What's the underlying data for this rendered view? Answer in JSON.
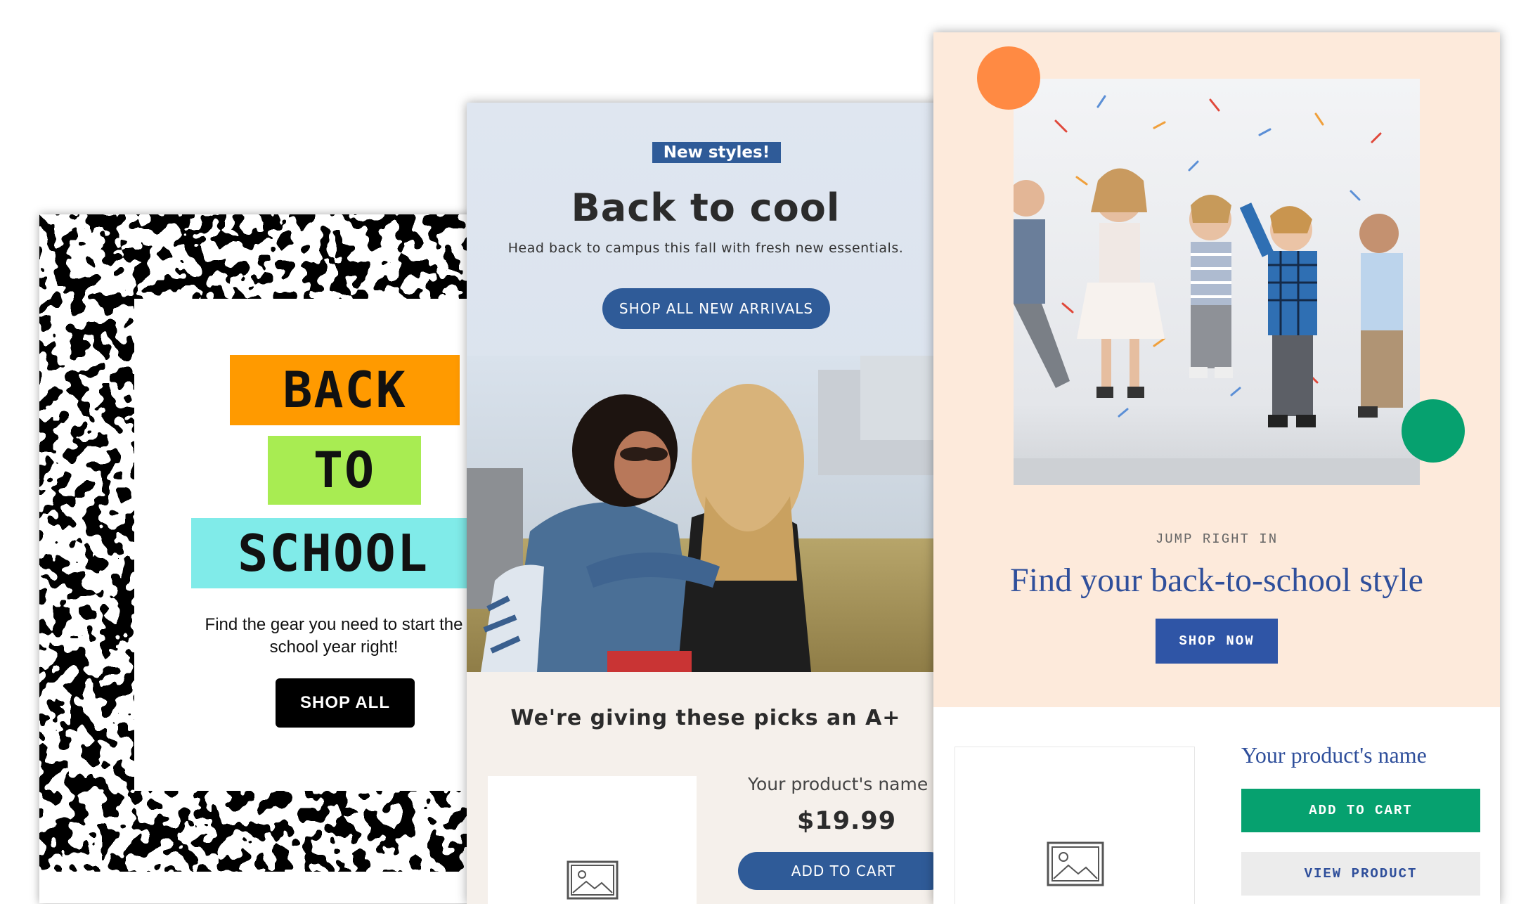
{
  "card_school": {
    "title_line1": "BACK",
    "title_line2": "TO",
    "title_line3": "SCHOOL",
    "subtext": "Find the gear you need to start the school year right!",
    "button_label": "SHOP ALL",
    "colors": {
      "orange": "#ff9a00",
      "green": "#a8ec52",
      "cyan": "#80ebe9"
    }
  },
  "card_cool": {
    "badge": "New styles!",
    "headline": "Back to cool",
    "subtext": "Head back to campus this fall with fresh new essentials.",
    "primary_button": "SHOP ALL NEW ARRIVALS",
    "section_title": "We're giving these picks an A+",
    "product_name": "Your product's name",
    "price": "$19.99",
    "add_to_cart": "ADD TO CART",
    "image_icon": "image-placeholder-icon",
    "colors": {
      "accent": "#2f5b98",
      "background": "#f5f0eb"
    }
  },
  "card_jump": {
    "kicker": "JUMP RIGHT IN",
    "headline": "Find your back-to-school style",
    "primary_button": "SHOP NOW",
    "product_name": "Your product's name",
    "add_to_cart": "ADD TO CART",
    "view_product": "VIEW PRODUCT",
    "image_icon": "image-placeholder-icon",
    "colors": {
      "accent": "#2f55a6",
      "green": "#06a16f",
      "peach": "#fdeadb",
      "orange": "#ff8a43"
    }
  }
}
